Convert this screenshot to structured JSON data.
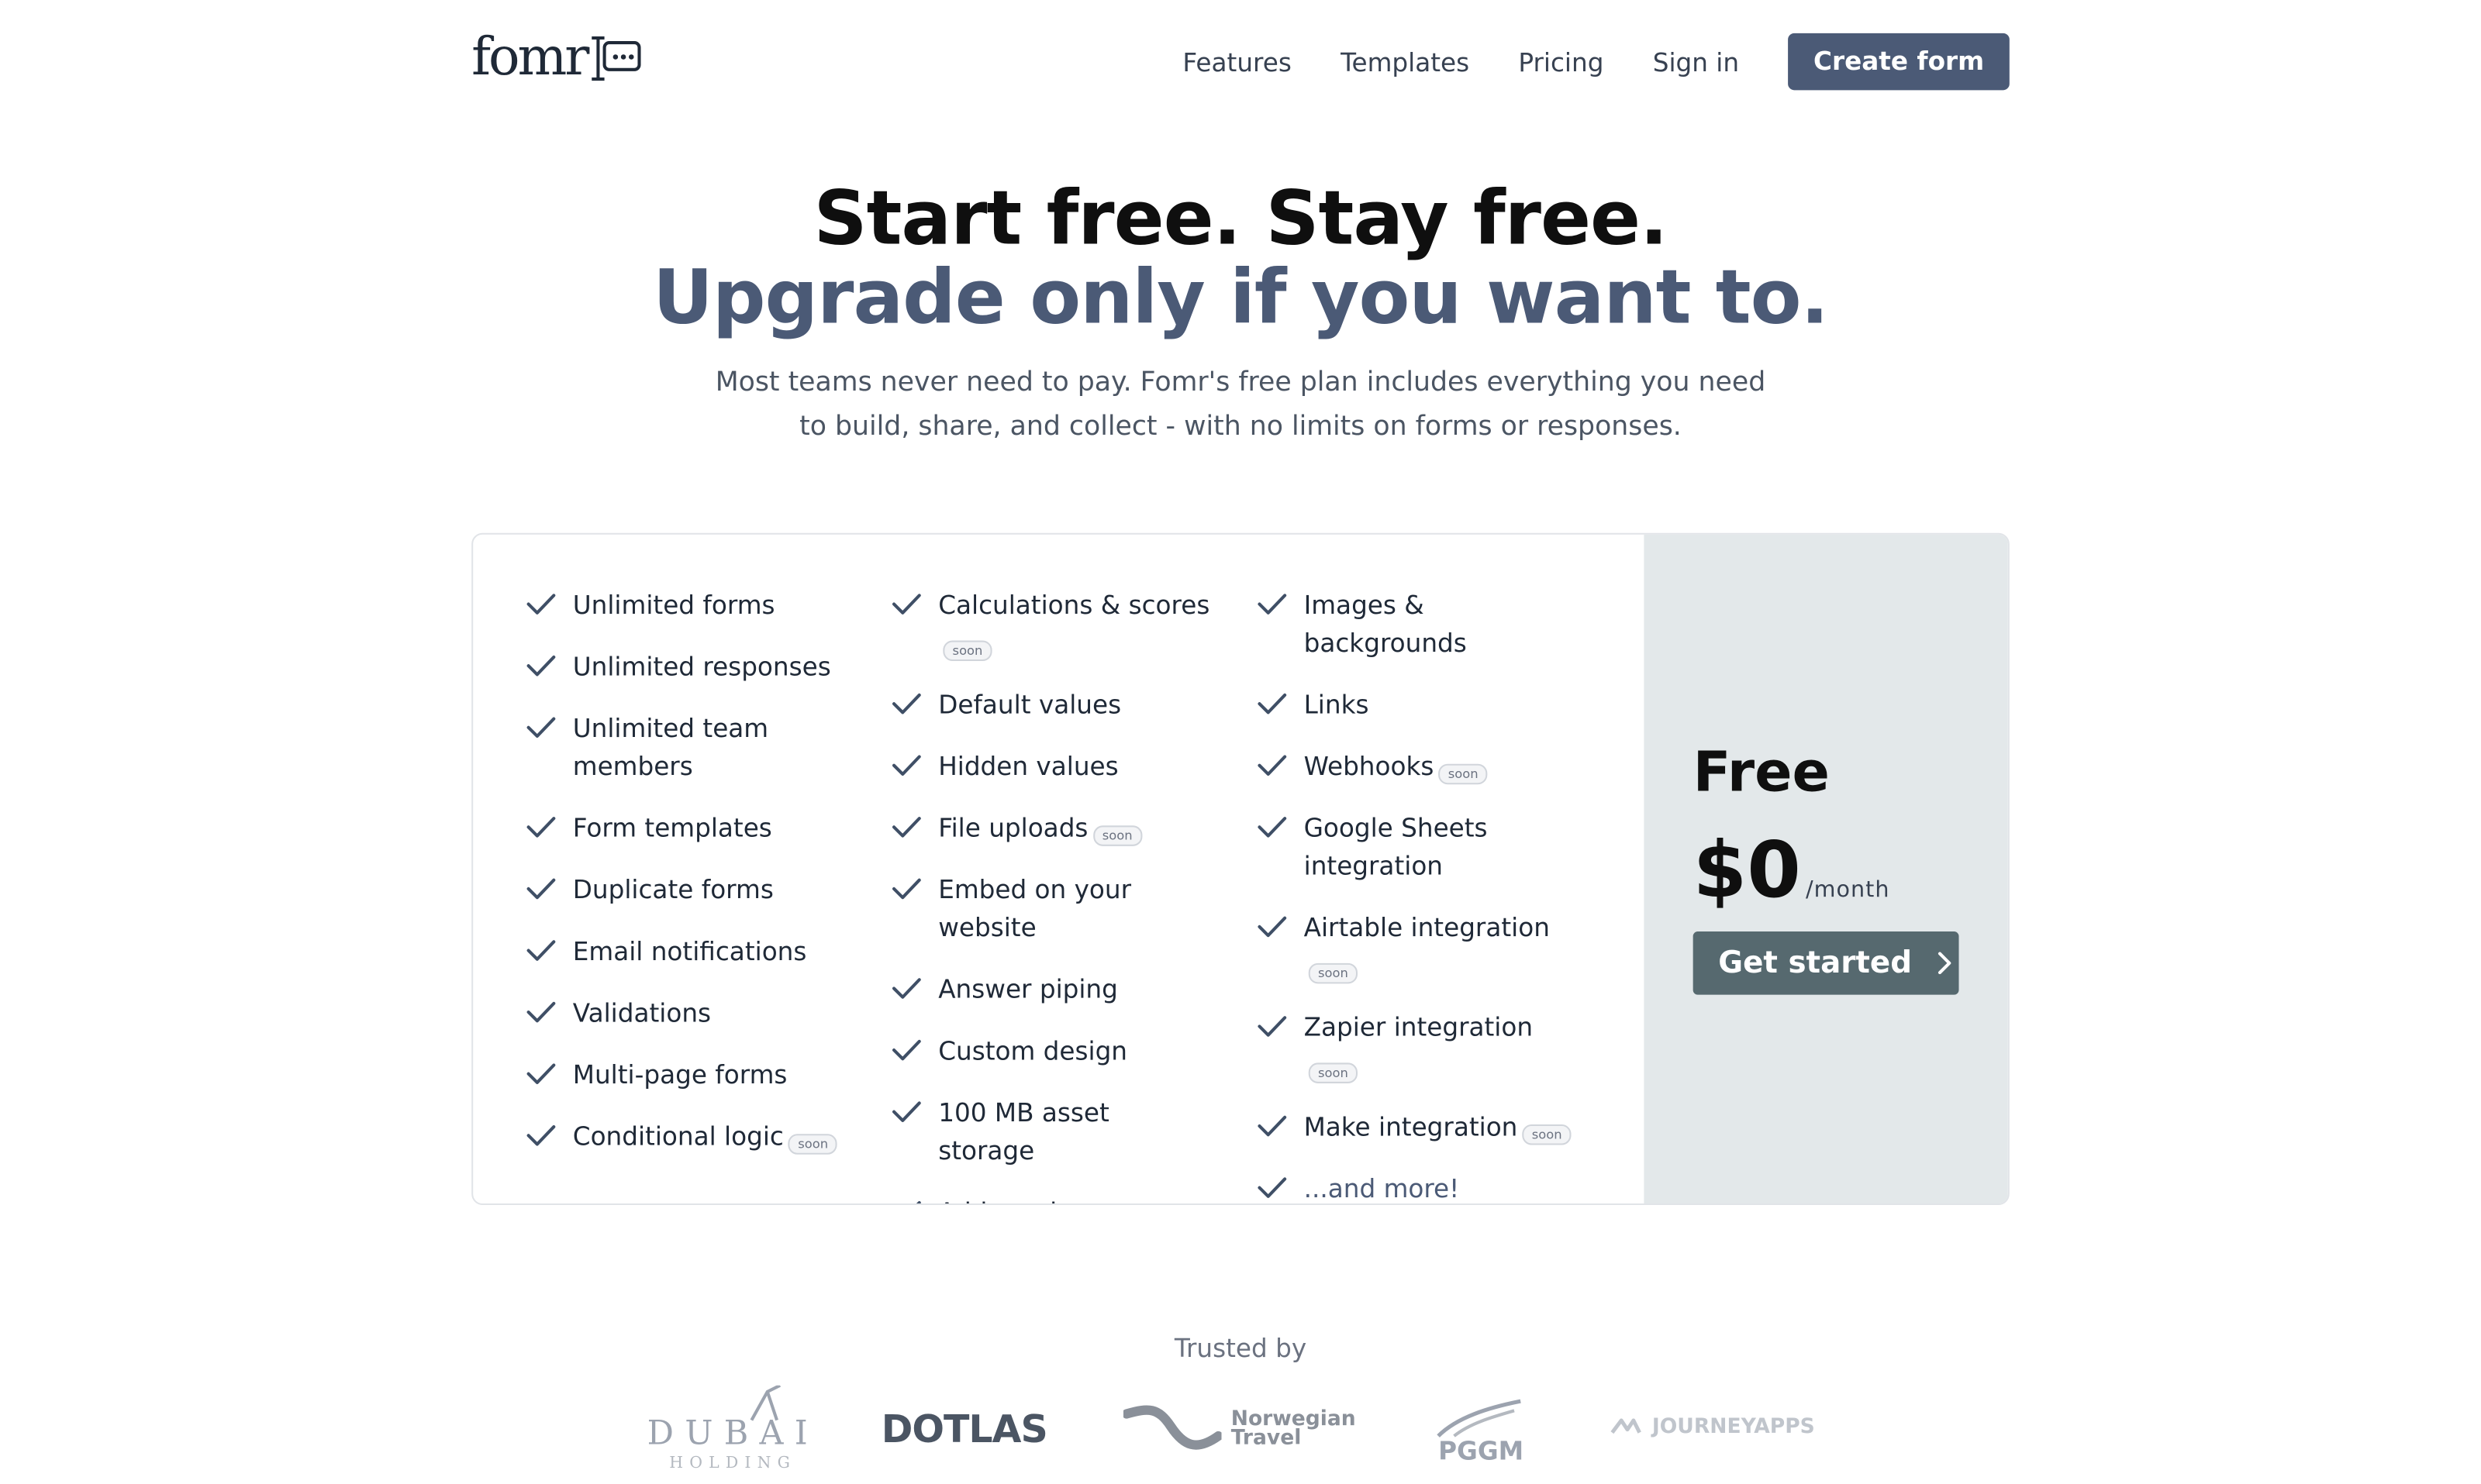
{
  "header": {
    "logo_text": "fomr",
    "nav": [
      "Features",
      "Templates",
      "Pricing",
      "Sign in"
    ],
    "cta": "Create form"
  },
  "hero": {
    "title_line1": "Start free. Stay free.",
    "title_line2": "Upgrade only if you want to.",
    "subtitle": "Most teams never need to pay. Fomr's free plan includes everything you need to build, share, and collect - with no limits on forms or responses."
  },
  "features": {
    "soon_label": "soon",
    "col1": [
      {
        "text": "Unlimited forms"
      },
      {
        "text": "Unlimited responses"
      },
      {
        "text": "Unlimited team members"
      },
      {
        "text": "Form templates"
      },
      {
        "text": "Duplicate forms"
      },
      {
        "text": "Email notifications"
      },
      {
        "text": "Validations"
      },
      {
        "text": "Multi-page forms"
      },
      {
        "text": "Conditional logic",
        "soon": true
      }
    ],
    "col2": [
      {
        "text": "Calculations & scores",
        "soon": true
      },
      {
        "text": "Default values"
      },
      {
        "text": "Hidden values"
      },
      {
        "text": "File uploads",
        "soon": true
      },
      {
        "text": "Embed on your website"
      },
      {
        "text": "Answer piping"
      },
      {
        "text": "Custom design"
      },
      {
        "text": "100 MB asset storage"
      },
      {
        "text": "Add you logo"
      }
    ],
    "col3": [
      {
        "text": "Images & backgrounds"
      },
      {
        "text": "Links"
      },
      {
        "text": "Webhooks",
        "soon": true
      },
      {
        "text": "Google Sheets integration"
      },
      {
        "text": "Airtable integration",
        "soon": true
      },
      {
        "text": "Zapier integration",
        "soon": true
      },
      {
        "text": "Make integration",
        "soon": true
      },
      {
        "text": "...and more!",
        "more": true
      }
    ]
  },
  "plan": {
    "name": "Free",
    "price": "$0",
    "unit": "/month",
    "cta": "Get started"
  },
  "trusted": {
    "label": "Trusted by",
    "logos": {
      "dubai": "DUBAI",
      "dubai_sub": "HOLDING",
      "dotlas": "DOTLAS",
      "norwegian_1": "Norwegian",
      "norwegian_2": "Travel",
      "pggm": "PGGM",
      "journeyapps": "JOURNEYAPPS"
    }
  },
  "colors": {
    "accent": "#4b5a76",
    "plan_bg": "#e3e8ea",
    "cta_plan": "#56696f"
  }
}
